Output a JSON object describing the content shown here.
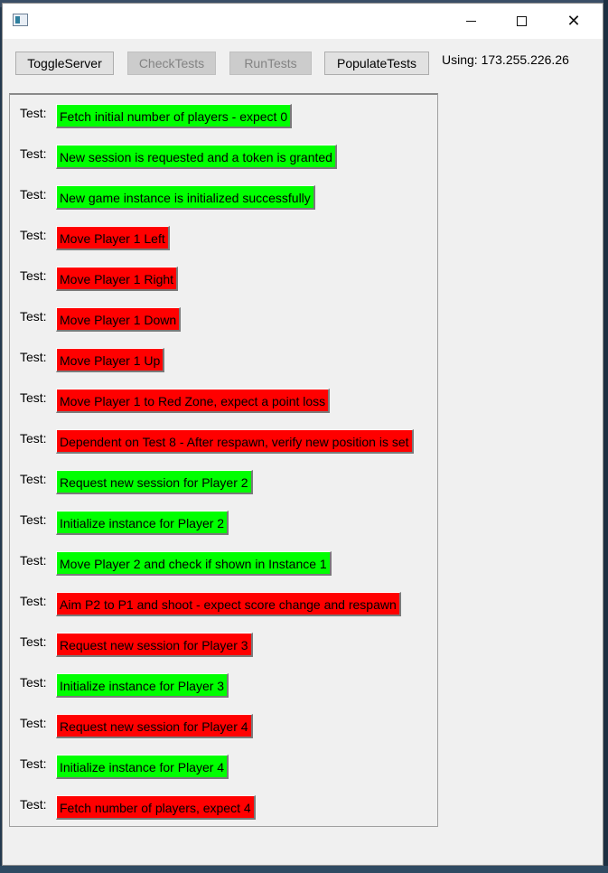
{
  "window": {
    "controls": {
      "minimize": "minimize-icon",
      "maximize": "maximize-icon",
      "close": "close-icon"
    }
  },
  "toolbar": {
    "toggle_server": "ToggleServer",
    "check_tests": "CheckTests",
    "run_tests": "RunTests",
    "populate_tests": "PopulateTests",
    "using": "Using: 173.255.226.26"
  },
  "colors": {
    "pass": "#00ff00",
    "fail": "#ff0000"
  },
  "tests": [
    {
      "label": "Test:",
      "name": "Fetch initial number of players - expect 0",
      "status": "pass"
    },
    {
      "label": "Test:",
      "name": "New session is requested and a token is granted",
      "status": "pass"
    },
    {
      "label": "Test:",
      "name": "New game instance is initialized successfully",
      "status": "pass"
    },
    {
      "label": "Test:",
      "name": "Move Player 1 Left",
      "status": "fail"
    },
    {
      "label": "Test:",
      "name": "Move Player 1 Right",
      "status": "fail"
    },
    {
      "label": "Test:",
      "name": "Move Player 1 Down",
      "status": "fail"
    },
    {
      "label": "Test:",
      "name": "Move Player 1 Up",
      "status": "fail"
    },
    {
      "label": "Test:",
      "name": "Move Player 1 to Red Zone, expect a point loss",
      "status": "fail"
    },
    {
      "label": "Test:",
      "name": "Dependent on Test 8 - After respawn, verify new position is set",
      "status": "fail"
    },
    {
      "label": "Test:",
      "name": "Request new session for Player 2",
      "status": "pass"
    },
    {
      "label": "Test:",
      "name": "Initialize instance for Player 2",
      "status": "pass"
    },
    {
      "label": "Test:",
      "name": "Move Player 2 and check if shown in Instance 1",
      "status": "pass"
    },
    {
      "label": "Test:",
      "name": "Aim P2 to P1 and shoot - expect score change and respawn",
      "status": "fail"
    },
    {
      "label": "Test:",
      "name": "Request new session for Player 3",
      "status": "fail"
    },
    {
      "label": "Test:",
      "name": "Initialize instance for Player 3",
      "status": "pass"
    },
    {
      "label": "Test:",
      "name": "Request new session for Player 4",
      "status": "fail"
    },
    {
      "label": "Test:",
      "name": "Initialize instance for Player 4",
      "status": "pass"
    },
    {
      "label": "Test:",
      "name": "Fetch number of players, expect 4",
      "status": "fail"
    }
  ]
}
